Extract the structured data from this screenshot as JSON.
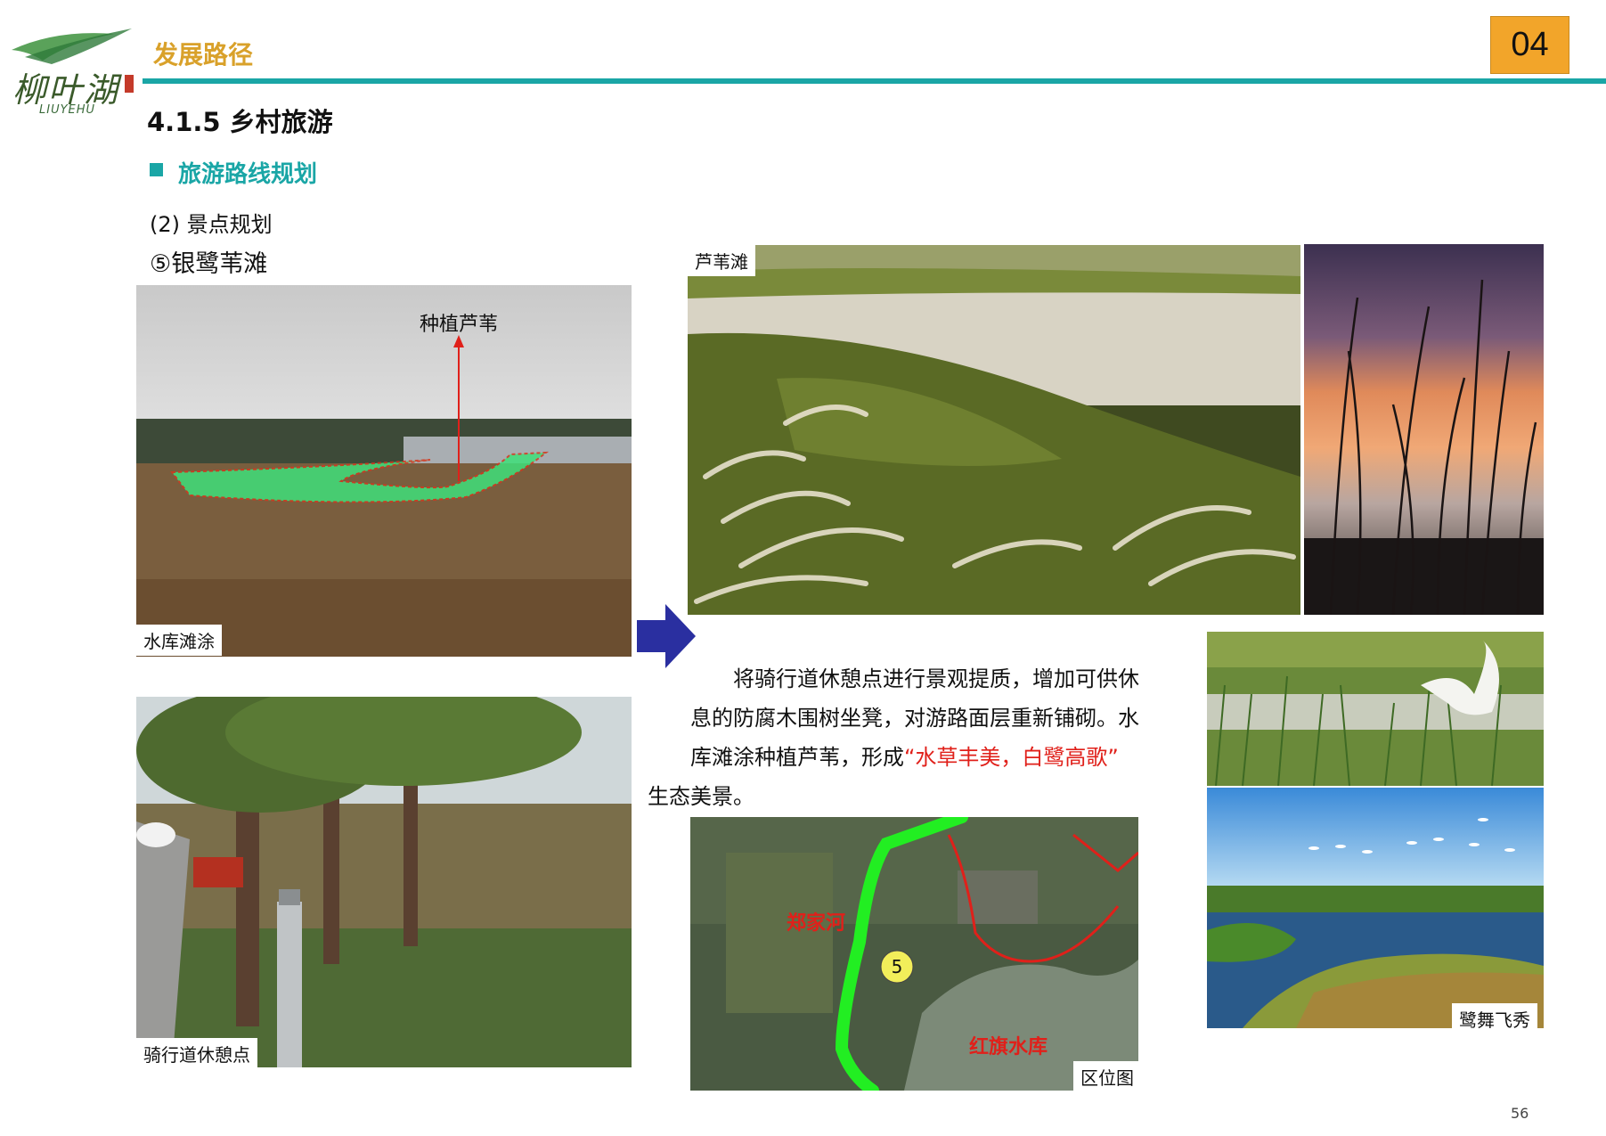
{
  "header": {
    "logo_cn": "柳叶湖",
    "logo_en": "LIUYEHU",
    "section_title": "发展路径",
    "page_badge": "04"
  },
  "headings": {
    "h1": "4.1.5  乡村旅游",
    "h2": "旅游路线规划",
    "item1": "(2) 景点规划",
    "item2": "⑤银鹭苇滩"
  },
  "photos": {
    "reservoir": {
      "caption": "水库滩涂",
      "annotation": "种植芦苇"
    },
    "rest_point": {
      "caption": "骑行道休憩点"
    },
    "reed_beach": {
      "caption": "芦苇滩"
    },
    "sunset_reeds": {
      "caption": ""
    },
    "egret": {
      "caption": ""
    },
    "wetland": {
      "caption": "鹭舞飞秀"
    },
    "location_map": {
      "caption": "区位图",
      "label_river": "郑家河",
      "label_reservoir": "红旗水库",
      "marker": "5"
    }
  },
  "body": {
    "text_before": "将骑行道休憩点进行景观提质，增加可供休息的防腐木围树坐凳，对游路面层重新铺砌。水库滩涂种植芦苇，形成",
    "quote": "“水草丰美，白鹭高歌”",
    "text_after": "生态美景。"
  },
  "footer": {
    "page_number": "56"
  },
  "colors": {
    "teal": "#1aa6a6",
    "gold": "#d9a12a",
    "badge": "#f2a52a",
    "red": "#e0201a",
    "route_green": "#22ee22"
  }
}
